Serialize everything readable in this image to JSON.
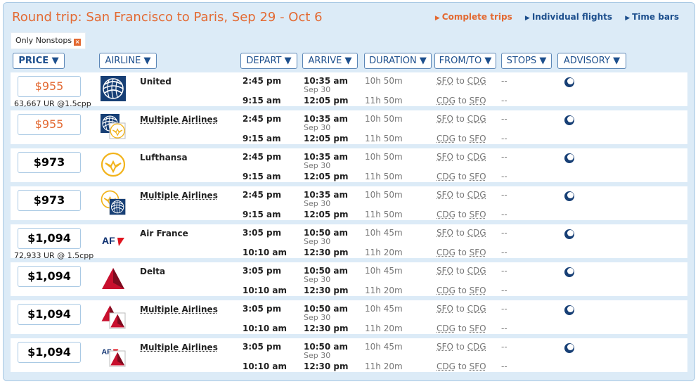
{
  "header": {
    "title": "Round trip: San Francisco to Paris, Sep 29 - Oct 6",
    "links": [
      {
        "label": "Complete trips",
        "active": true
      },
      {
        "label": "Individual flights",
        "active": false
      },
      {
        "label": "Time bars",
        "active": false
      }
    ],
    "arrow_glyph": "▶"
  },
  "filter": {
    "label": "Only Nonstops",
    "close_glyph": "×"
  },
  "columns": {
    "price": "PRICE ▼",
    "airline": "AIRLINE ▼",
    "depart": "DEPART ▼",
    "arrive": "ARRIVE ▼",
    "duration": "DURATION ▼",
    "fromto": "FROM/TO ▼",
    "stops": "STOPS ▼",
    "advisory": "ADVISORY ▼"
  },
  "rows": [
    {
      "price": "$955",
      "orange": true,
      "points": "63,667 UR @1.5cpp",
      "airline": "United",
      "multi": false,
      "logo": "united",
      "out": {
        "depart": "2:45 pm",
        "arrive": "10:35 am",
        "arrive_date": "Sep 30",
        "duration": "10h 50m",
        "from": "SFO",
        "to": "CDG",
        "stops": "--"
      },
      "ret": {
        "depart": "9:15 am",
        "arrive": "12:05 pm",
        "duration": "11h 50m",
        "from": "CDG",
        "to": "SFO",
        "stops": "--"
      }
    },
    {
      "price": "$955",
      "orange": true,
      "points": "",
      "airline": "Multiple Airlines",
      "multi": true,
      "logo": "united-lufthansa",
      "out": {
        "depart": "2:45 pm",
        "arrive": "10:35 am",
        "arrive_date": "Sep 30",
        "duration": "10h 50m",
        "from": "SFO",
        "to": "CDG",
        "stops": "--"
      },
      "ret": {
        "depart": "9:15 am",
        "arrive": "12:05 pm",
        "duration": "11h 50m",
        "from": "CDG",
        "to": "SFO",
        "stops": "--"
      }
    },
    {
      "price": "$973",
      "orange": false,
      "points": "",
      "airline": "Lufthansa",
      "multi": false,
      "logo": "lufthansa",
      "out": {
        "depart": "2:45 pm",
        "arrive": "10:35 am",
        "arrive_date": "Sep 30",
        "duration": "10h 50m",
        "from": "SFO",
        "to": "CDG",
        "stops": "--"
      },
      "ret": {
        "depart": "9:15 am",
        "arrive": "12:05 pm",
        "duration": "11h 50m",
        "from": "CDG",
        "to": "SFO",
        "stops": "--"
      }
    },
    {
      "price": "$973",
      "orange": false,
      "points": "",
      "airline": "Multiple Airlines",
      "multi": true,
      "logo": "lufthansa-united",
      "out": {
        "depart": "2:45 pm",
        "arrive": "10:35 am",
        "arrive_date": "Sep 30",
        "duration": "10h 50m",
        "from": "SFO",
        "to": "CDG",
        "stops": "--"
      },
      "ret": {
        "depart": "9:15 am",
        "arrive": "12:05 pm",
        "duration": "11h 50m",
        "from": "CDG",
        "to": "SFO",
        "stops": "--"
      }
    },
    {
      "price": "$1,094",
      "orange": false,
      "points": "72,933 UR @ 1.5cpp",
      "airline": "Air France",
      "multi": false,
      "logo": "airfrance",
      "logo_text": "AF",
      "out": {
        "depart": "3:05 pm",
        "arrive": "10:50 am",
        "arrive_date": "Sep 30",
        "duration": "10h 45m",
        "from": "SFO",
        "to": "CDG",
        "stops": "--"
      },
      "ret": {
        "depart": "10:10 am",
        "arrive": "12:30 pm",
        "duration": "11h 20m",
        "from": "CDG",
        "to": "SFO",
        "stops": "--"
      }
    },
    {
      "price": "$1,094",
      "orange": false,
      "points": "",
      "airline": "Delta",
      "multi": false,
      "logo": "delta",
      "out": {
        "depart": "3:05 pm",
        "arrive": "10:50 am",
        "arrive_date": "Sep 30",
        "duration": "10h 45m",
        "from": "SFO",
        "to": "CDG",
        "stops": "--"
      },
      "ret": {
        "depart": "10:10 am",
        "arrive": "12:30 pm",
        "duration": "11h 20m",
        "from": "CDG",
        "to": "SFO",
        "stops": "--"
      }
    },
    {
      "price": "$1,094",
      "orange": false,
      "points": "",
      "airline": "Multiple Airlines",
      "multi": true,
      "logo": "delta-multi",
      "out": {
        "depart": "3:05 pm",
        "arrive": "10:50 am",
        "arrive_date": "Sep 30",
        "duration": "10h 45m",
        "from": "SFO",
        "to": "CDG",
        "stops": "--"
      },
      "ret": {
        "depart": "10:10 am",
        "arrive": "12:30 pm",
        "duration": "11h 20m",
        "from": "CDG",
        "to": "SFO",
        "stops": "--"
      }
    },
    {
      "price": "$1,094",
      "orange": false,
      "points": "",
      "airline": "Multiple Airlines",
      "multi": true,
      "logo": "airfrance-delta",
      "logo_text": "AF",
      "out": {
        "depart": "3:05 pm",
        "arrive": "10:50 am",
        "arrive_date": "Sep 30",
        "duration": "10h 45m",
        "from": "SFO",
        "to": "CDG",
        "stops": "--"
      },
      "ret": {
        "depart": "10:10 am",
        "arrive": "12:30 pm",
        "duration": "11h 20m",
        "from": "CDG",
        "to": "SFO",
        "stops": "--"
      }
    }
  ],
  "route_joiner": "to",
  "colors": {
    "accent": "#e36a33",
    "link": "#1d4f8d",
    "panel": "#dcebf7",
    "border": "#a9c9e4"
  }
}
